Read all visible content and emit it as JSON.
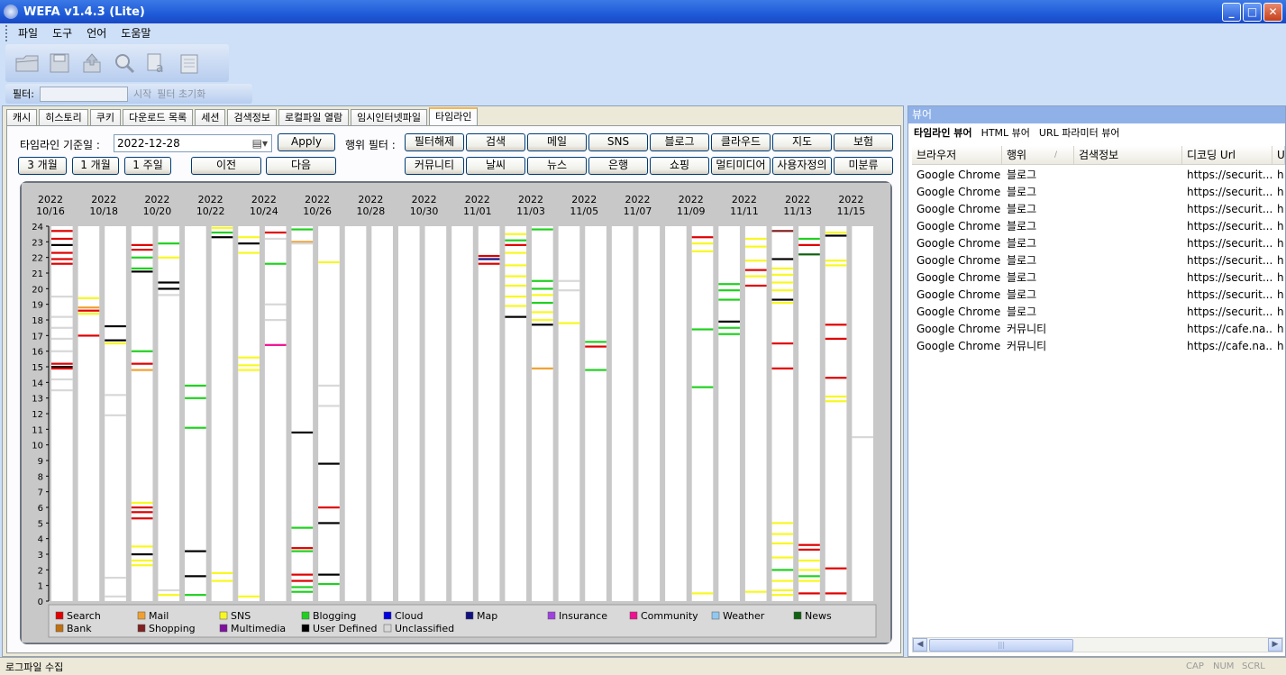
{
  "app": {
    "title": "WEFA v1.4.3 (Lite)"
  },
  "window_buttons": {
    "minimize": "_",
    "maximize": "□",
    "close": "✕"
  },
  "menu": [
    "파일",
    "도구",
    "언어",
    "도움말"
  ],
  "toolbar_icons": [
    "open-folder-icon",
    "save-icon",
    "export-icon",
    "magnifier-icon",
    "find-text-icon",
    "notepad-icon"
  ],
  "filter": {
    "label": "필터:",
    "start": "시작",
    "reset": "필터 초기화"
  },
  "tabs": [
    "캐시",
    "히스토리",
    "쿠키",
    "다운로드 목록",
    "세션",
    "검색정보",
    "로컬파일 열람",
    "임시인터넷파일",
    "타임라인"
  ],
  "timeline": {
    "date_label": "타임라인 기준일 :",
    "date_value": "2022-12-28",
    "apply": "Apply",
    "range_buttons": [
      "3 개월",
      "1 개월",
      "1 주일"
    ],
    "prev": "이전",
    "next": "다음",
    "action_filter_label": "행위 필터 :",
    "filters_row1": [
      "필터해제",
      "검색",
      "메일",
      "SNS",
      "블로그",
      "클라우드",
      "지도",
      "보험"
    ],
    "filters_row2": [
      "커뮤니티",
      "날씨",
      "뉴스",
      "은행",
      "쇼핑",
      "멀티미디어",
      "사용자정의",
      "미분류"
    ]
  },
  "chart_data": {
    "type": "heatmap",
    "x_ticks": [
      {
        "year": "2022",
        "md": "10/16"
      },
      {
        "year": "2022",
        "md": "10/18"
      },
      {
        "year": "2022",
        "md": "10/20"
      },
      {
        "year": "2022",
        "md": "10/22"
      },
      {
        "year": "2022",
        "md": "10/24"
      },
      {
        "year": "2022",
        "md": "10/26"
      },
      {
        "year": "2022",
        "md": "10/28"
      },
      {
        "year": "2022",
        "md": "10/30"
      },
      {
        "year": "2022",
        "md": "11/01"
      },
      {
        "year": "2022",
        "md": "11/03"
      },
      {
        "year": "2022",
        "md": "11/05"
      },
      {
        "year": "2022",
        "md": "11/07"
      },
      {
        "year": "2022",
        "md": "11/09"
      },
      {
        "year": "2022",
        "md": "11/11"
      },
      {
        "year": "2022",
        "md": "11/13"
      },
      {
        "year": "2022",
        "md": "11/15"
      }
    ],
    "y_ticks": [
      0,
      1,
      2,
      3,
      4,
      5,
      6,
      7,
      8,
      9,
      10,
      11,
      12,
      13,
      14,
      15,
      16,
      17,
      18,
      19,
      20,
      21,
      22,
      23,
      24
    ],
    "ylim": [
      0,
      24
    ],
    "days": [
      "10/16",
      "10/17",
      "10/18",
      "10/19",
      "10/20",
      "10/21",
      "10/22",
      "10/23",
      "10/24",
      "10/25",
      "10/26",
      "10/27",
      "10/28",
      "10/29",
      "10/30",
      "10/31",
      "11/01",
      "11/02",
      "11/03",
      "11/04",
      "11/05",
      "11/06",
      "11/07",
      "11/08",
      "11/09",
      "11/10",
      "11/11",
      "11/12",
      "11/13",
      "11/14",
      "11/15"
    ],
    "legend": [
      {
        "name": "Search",
        "color": "#e00000"
      },
      {
        "name": "Mail",
        "color": "#f0a030"
      },
      {
        "name": "SNS",
        "color": "#f8f820"
      },
      {
        "name": "Blogging",
        "color": "#20d020"
      },
      {
        "name": "Cloud",
        "color": "#0000e0"
      },
      {
        "name": "Map",
        "color": "#101080"
      },
      {
        "name": "Insurance",
        "color": "#a040e0"
      },
      {
        "name": "Community",
        "color": "#f01090"
      },
      {
        "name": "Weather",
        "color": "#90c8f0"
      },
      {
        "name": "News",
        "color": "#106010"
      },
      {
        "name": "Bank",
        "color": "#c07010"
      },
      {
        "name": "Shopping",
        "color": "#802020"
      },
      {
        "name": "Multimedia",
        "color": "#8010a0"
      },
      {
        "name": "User Defined",
        "color": "#000000"
      },
      {
        "name": "Unclassified",
        "color": "#d8d8d8"
      }
    ],
    "events": [
      {
        "day": 0,
        "hours": [
          23.7,
          23.2,
          22.8,
          22.3,
          21.9,
          21.6,
          15.2,
          15.0,
          14.9,
          19.5,
          18.2,
          17.5,
          16.8,
          16.0,
          14.2,
          13.5
        ],
        "cats": [
          "Search",
          "Search",
          "User Defined",
          "Search",
          "Search",
          "Search",
          "Search",
          "User Defined",
          "Search",
          "Unclassified",
          "Unclassified",
          "Unclassified",
          "Unclassified",
          "Unclassified",
          "Unclassified",
          "Unclassified"
        ]
      },
      {
        "day": 1,
        "hours": [
          19.4,
          18.8,
          18.6,
          18.4,
          17.0
        ],
        "cats": [
          "SNS",
          "Mail",
          "Search",
          "SNS",
          "Search"
        ]
      },
      {
        "day": 2,
        "hours": [
          17.6,
          16.7,
          16.5,
          13.2,
          11.9,
          1.5,
          0.3
        ],
        "cats": [
          "User Defined",
          "User Defined",
          "SNS",
          "Unclassified",
          "Unclassified",
          "Unclassified",
          "Unclassified"
        ]
      },
      {
        "day": 3,
        "hours": [
          22.8,
          22.5,
          22.0,
          21.3,
          21.1,
          16.0,
          15.2,
          14.8,
          6.3,
          6.0,
          5.7,
          5.3,
          3.5,
          3.0,
          2.6,
          2.3
        ],
        "cats": [
          "Search",
          "Search",
          "Blogging",
          "Blogging",
          "User Defined",
          "Blogging",
          "Search",
          "Mail",
          "SNS",
          "Search",
          "Search",
          "Search",
          "SNS",
          "User Defined",
          "SNS",
          "SNS"
        ]
      },
      {
        "day": 4,
        "hours": [
          22.9,
          22.0,
          20.4,
          20.0,
          19.6,
          0.7,
          0.4
        ],
        "cats": [
          "Blogging",
          "SNS",
          "User Defined",
          "User Defined",
          "Unclassified",
          "Unclassified",
          "SNS"
        ]
      },
      {
        "day": 5,
        "hours": [
          13.8,
          13.0,
          11.1,
          3.2,
          1.6,
          0.4
        ],
        "cats": [
          "Blogging",
          "Blogging",
          "Blogging",
          "User Defined",
          "User Defined",
          "Blogging"
        ]
      },
      {
        "day": 6,
        "hours": [
          23.9,
          23.6,
          23.3,
          1.8,
          1.3
        ],
        "cats": [
          "SNS",
          "Blogging",
          "User Defined",
          "SNS",
          "SNS"
        ]
      },
      {
        "day": 7,
        "hours": [
          23.3,
          22.9,
          22.3,
          15.6,
          15.1,
          14.8,
          0.3
        ],
        "cats": [
          "SNS",
          "User Defined",
          "SNS",
          "SNS",
          "SNS",
          "SNS",
          "SNS"
        ]
      },
      {
        "day": 8,
        "hours": [
          23.6,
          23.2,
          21.6,
          16.4,
          19.0,
          18.0
        ],
        "cats": [
          "Search",
          "Unclassified",
          "Blogging",
          "Community",
          "Unclassified",
          "Unclassified"
        ]
      },
      {
        "day": 9,
        "hours": [
          23.8,
          23.0,
          22.9,
          10.8,
          4.7,
          3.4,
          3.2,
          1.7,
          1.3,
          0.9,
          0.6
        ],
        "cats": [
          "Blogging",
          "Mail",
          "Unclassified",
          "User Defined",
          "Blogging",
          "Search",
          "Blogging",
          "Search",
          "Search",
          "Blogging",
          "Blogging"
        ]
      },
      {
        "day": 10,
        "hours": [
          21.7,
          8.8,
          6.0,
          5.0,
          1.7,
          1.1,
          13.8,
          12.5
        ],
        "cats": [
          "SNS",
          "User Defined",
          "Search",
          "User Defined",
          "User Defined",
          "Blogging",
          "Unclassified",
          "Unclassified"
        ]
      },
      {
        "day": 16,
        "hours": [
          22.1,
          21.9,
          21.6
        ],
        "cats": [
          "Search",
          "Map",
          "Search"
        ]
      },
      {
        "day": 17,
        "hours": [
          23.5,
          23.1,
          22.8,
          22.3,
          21.5,
          20.8,
          20.2,
          19.5,
          18.9,
          18.2
        ],
        "cats": [
          "SNS",
          "Blogging",
          "Search",
          "SNS",
          "SNS",
          "SNS",
          "SNS",
          "SNS",
          "SNS",
          "User Defined"
        ]
      },
      {
        "day": 18,
        "hours": [
          23.8,
          20.5,
          20.0,
          19.6,
          19.1,
          18.5,
          18.0,
          17.7,
          14.9
        ],
        "cats": [
          "Blogging",
          "Blogging",
          "Blogging",
          "SNS",
          "Blogging",
          "SNS",
          "SNS",
          "User Defined",
          "Mail"
        ]
      },
      {
        "day": 19,
        "hours": [
          20.5,
          19.9,
          17.8
        ],
        "cats": [
          "Unclassified",
          "Unclassified",
          "SNS"
        ]
      },
      {
        "day": 20,
        "hours": [
          16.6,
          16.3,
          14.8
        ],
        "cats": [
          "Blogging",
          "Search",
          "Blogging"
        ]
      },
      {
        "day": 24,
        "hours": [
          23.3,
          22.9,
          22.4,
          17.4,
          13.7,
          0.5
        ],
        "cats": [
          "Search",
          "SNS",
          "SNS",
          "Blogging",
          "Blogging",
          "SNS"
        ]
      },
      {
        "day": 25,
        "hours": [
          20.3,
          19.9,
          19.3,
          17.9,
          17.5,
          17.1
        ],
        "cats": [
          "Blogging",
          "Blogging",
          "Blogging",
          "User Defined",
          "Blogging",
          "Blogging"
        ]
      },
      {
        "day": 26,
        "hours": [
          23.2,
          22.7,
          21.8,
          21.2,
          20.8,
          20.2,
          0.6
        ],
        "cats": [
          "SNS",
          "SNS",
          "SNS",
          "Search",
          "SNS",
          "Search",
          "SNS"
        ]
      },
      {
        "day": 27,
        "hours": [
          23.7,
          21.9,
          21.3,
          20.9,
          20.4,
          19.9,
          19.3,
          19.1,
          16.5,
          14.9,
          5.0,
          4.3,
          3.7,
          2.8,
          2.0,
          1.3,
          0.7,
          0.4
        ],
        "cats": [
          "Shopping",
          "User Defined",
          "SNS",
          "SNS",
          "SNS",
          "SNS",
          "User Defined",
          "SNS",
          "Search",
          "Search",
          "SNS",
          "SNS",
          "SNS",
          "SNS",
          "Blogging",
          "SNS",
          "SNS",
          "SNS"
        ]
      },
      {
        "day": 28,
        "hours": [
          23.2,
          22.8,
          22.2,
          3.6,
          3.3,
          2.6,
          2.0,
          1.6,
          1.3,
          0.5
        ],
        "cats": [
          "Blogging",
          "Search",
          "News",
          "Search",
          "Search",
          "SNS",
          "SNS",
          "Blogging",
          "SNS",
          "Search"
        ]
      },
      {
        "day": 29,
        "hours": [
          23.6,
          23.4,
          21.8,
          21.5,
          17.7,
          16.8,
          14.3,
          13.1,
          12.8,
          2.1,
          0.5
        ],
        "cats": [
          "SNS",
          "User Defined",
          "SNS",
          "SNS",
          "Search",
          "Search",
          "Search",
          "SNS",
          "SNS",
          "Search",
          "Search"
        ]
      },
      {
        "day": 30,
        "hours": [
          10.5
        ],
        "cats": [
          "Unclassified"
        ]
      }
    ]
  },
  "viewer": {
    "title": "뷰어",
    "tabs": [
      "타임라인 뷰어",
      "HTML 뷰어",
      "URL 파라미터 뷰어"
    ],
    "columns": [
      "브라우저",
      "행위",
      "검색정보",
      "디코딩 Url",
      "U"
    ],
    "sort_indicator": "∕",
    "rows": [
      [
        "Google Chrome",
        "블로그",
        "",
        "https://securit...",
        "h"
      ],
      [
        "Google Chrome",
        "블로그",
        "",
        "https://securit...",
        "h"
      ],
      [
        "Google Chrome",
        "블로그",
        "",
        "https://securit...",
        "h"
      ],
      [
        "Google Chrome",
        "블로그",
        "",
        "https://securit...",
        "h"
      ],
      [
        "Google Chrome",
        "블로그",
        "",
        "https://securit...",
        "h"
      ],
      [
        "Google Chrome",
        "블로그",
        "",
        "https://securit...",
        "h"
      ],
      [
        "Google Chrome",
        "블로그",
        "",
        "https://securit...",
        "h"
      ],
      [
        "Google Chrome",
        "블로그",
        "",
        "https://securit...",
        "h"
      ],
      [
        "Google Chrome",
        "블로그",
        "",
        "https://securit...",
        "h"
      ],
      [
        "Google Chrome",
        "커뮤니티",
        "",
        "https://cafe.na...",
        "h"
      ],
      [
        "Google Chrome",
        "커뮤니티",
        "",
        "https://cafe.na...",
        "h"
      ]
    ]
  },
  "status": {
    "text": "로그파일 수집",
    "caps": "CAP",
    "num": "NUM",
    "scrl": "SCRL"
  }
}
